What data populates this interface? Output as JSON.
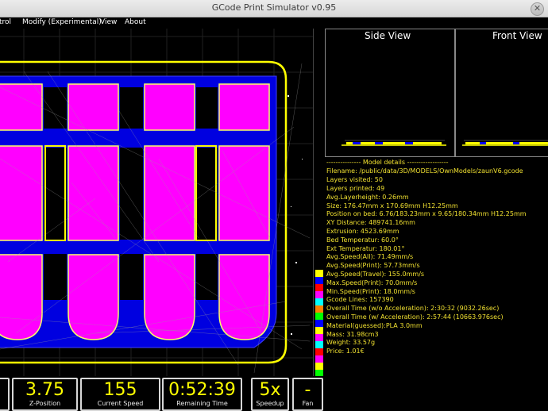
{
  "window": {
    "title": "GCode Print Simulator v0.95",
    "close_glyph": "✕"
  },
  "menu": {
    "items": [
      "trol",
      "Modify (Experimental)",
      "View",
      "About"
    ]
  },
  "views": {
    "side_title": "Side View",
    "front_title": "Front View"
  },
  "model_details": [
    "--------------- Model details ------------------",
    "Filename:  /public/data/3D/MODELS/OwnModels/zaunV6.gcode",
    "Layers visited:  50",
    "Layers printed:  49",
    "Avg.Layerheight: 0.26mm",
    "Size:            176.47mm x 170.69mm H12.25mm",
    "Position on bed: 6.76/183.23mm x 9.65/180.34mm H12.25mm",
    "XY Distance:     489741.16mm",
    "Extrusion:       4523.69mm",
    "Bed Temperatur:  60.0°",
    "Ext Temperatur:  180.01°",
    "Avg.Speed(All):     71.49mm/s",
    "Avg.Speed(Print):  57.73mm/s",
    "Avg.Speed(Travel):  155.0mm/s",
    "Max.Speed(Print):  70.0mm/s",
    "Min.Speed(Print):  18.0mm/s",
    "Gcode Lines:     157390",
    "Overall Time (w/o Acceleration):   2:30:32 (9032.26sec)",
    "Overall Time (w/ Acceleration):   2:57:44 (10663.976sec)",
    "Material(guessed):PLA 3.0mm",
    "Mass:   31.98cm3",
    "Weight: 33.57g",
    "Price:  1.01€"
  ],
  "layer_colors": [
    "#ffff00",
    "#0000ff",
    "#ff0000",
    "#ff00ff",
    "#00ffff",
    "#ff8000",
    "#00ff00",
    "#0000ff",
    "#ffff00",
    "#ff00ff",
    "#00ffff",
    "#ff0000",
    "#ff00ff",
    "#ffff00",
    "#00ff00"
  ],
  "status": {
    "layer_value": "",
    "zpos_value": "3.75",
    "zpos_label": "Z-Position",
    "speed_value": "155",
    "speed_label": "Current Speed",
    "remaining_value": "0:52:39",
    "remaining_label": "Remaining Time",
    "speedup_value": "5x",
    "speedup_label": "Speedup",
    "fan_value": "-",
    "fan_label": "Fan"
  },
  "colors": {
    "infill": "#ff00ff",
    "travel": "#0000ff",
    "perimeter": "#ffff00",
    "detail_text": "#f0e030",
    "status_value": "#ffff00"
  }
}
